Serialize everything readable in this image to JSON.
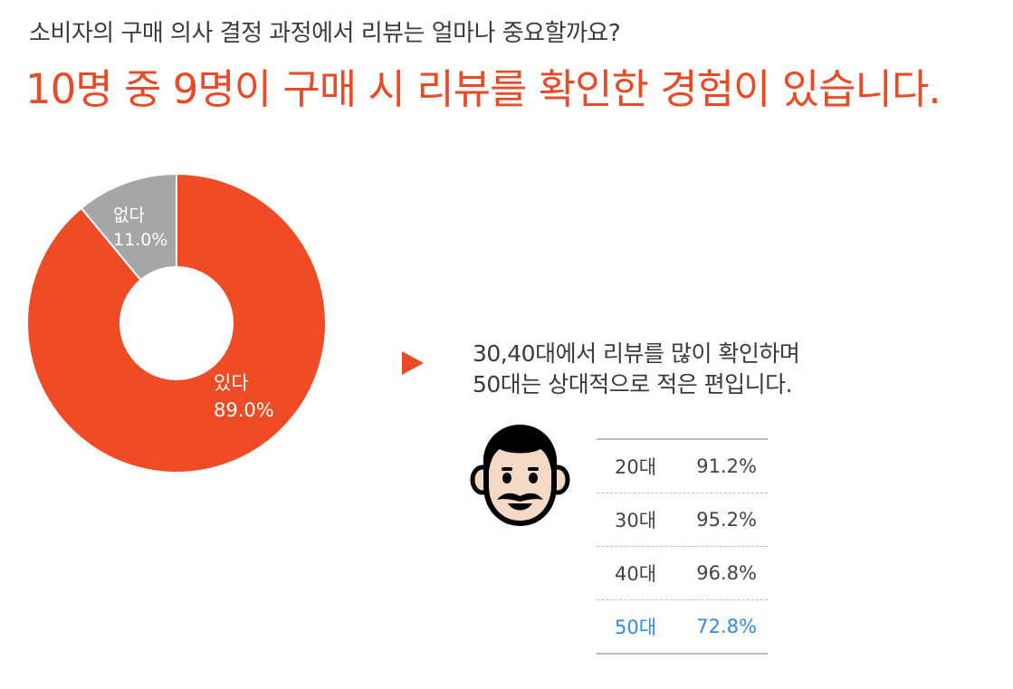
{
  "header": {
    "subtitle": "소비자의 구매 의사 결정 과정에서 리뷰는 얼마나 중요할까요?",
    "headline": "10명 중 9명이 구매 시 리뷰를 확인한 경험이 있습니다."
  },
  "chart_data": {
    "type": "pie",
    "categories": [
      "있다",
      "없다"
    ],
    "values": [
      89.0,
      11.0
    ],
    "value_labels": [
      "89.0%",
      "11.0%"
    ],
    "colors": [
      "#ef4b25",
      "#a6a6a6"
    ],
    "donut": true
  },
  "note": {
    "line1": "30,40대에서 리뷰를 많이 확인하며",
    "line2": "50대는 상대적으로 적은 편입니다."
  },
  "age_table": {
    "rows": [
      {
        "age": "20대",
        "value": "91.2%"
      },
      {
        "age": "30대",
        "value": "95.2%"
      },
      {
        "age": "40대",
        "value": "96.8%"
      },
      {
        "age": "50대",
        "value": "72.8%"
      }
    ],
    "highlight_color": "#2e8be6"
  },
  "icons": {
    "face": "man-face-icon",
    "arrow": "triangle-right-icon"
  }
}
